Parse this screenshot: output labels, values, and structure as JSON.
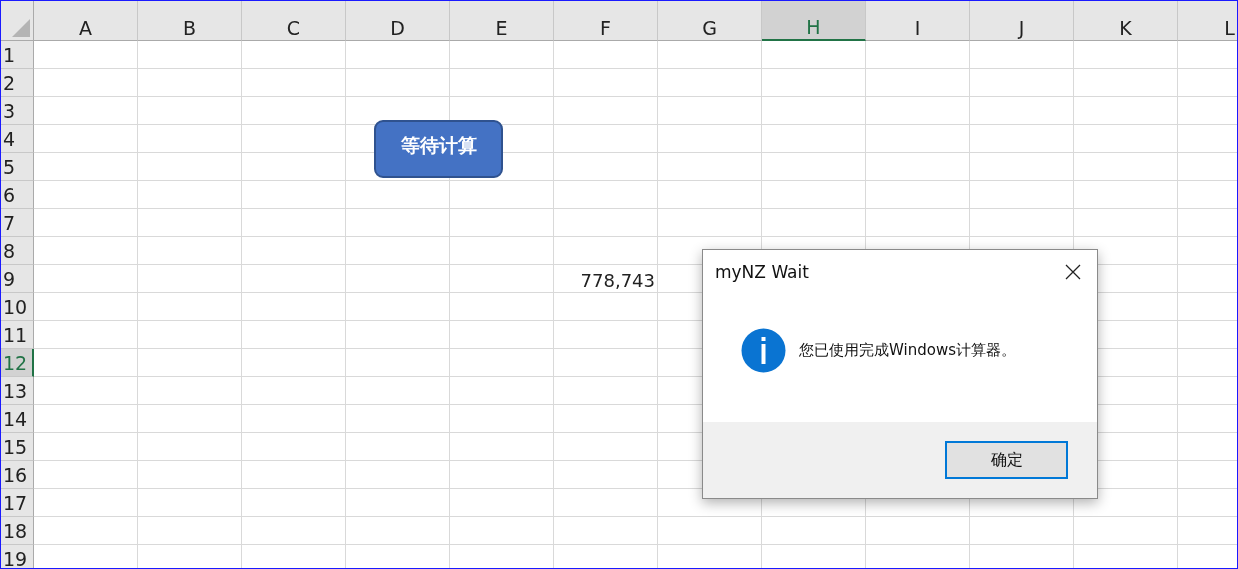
{
  "columns": [
    {
      "label": "A",
      "selected": false
    },
    {
      "label": "B",
      "selected": false
    },
    {
      "label": "C",
      "selected": false
    },
    {
      "label": "D",
      "selected": false
    },
    {
      "label": "E",
      "selected": false
    },
    {
      "label": "F",
      "selected": false
    },
    {
      "label": "G",
      "selected": false
    },
    {
      "label": "H",
      "selected": true
    },
    {
      "label": "I",
      "selected": false
    },
    {
      "label": "J",
      "selected": false
    },
    {
      "label": "K",
      "selected": false
    },
    {
      "label": "L",
      "selected": false
    }
  ],
  "rows": [
    {
      "label": "1",
      "selected": false
    },
    {
      "label": "2",
      "selected": false
    },
    {
      "label": "3",
      "selected": false
    },
    {
      "label": "4",
      "selected": false
    },
    {
      "label": "5",
      "selected": false
    },
    {
      "label": "6",
      "selected": false
    },
    {
      "label": "7",
      "selected": false
    },
    {
      "label": "8",
      "selected": false
    },
    {
      "label": "9",
      "selected": false,
      "cells": {
        "F": "778,743"
      }
    },
    {
      "label": "10",
      "selected": false
    },
    {
      "label": "11",
      "selected": false
    },
    {
      "label": "12",
      "selected": true
    },
    {
      "label": "13",
      "selected": false
    },
    {
      "label": "14",
      "selected": false
    },
    {
      "label": "15",
      "selected": false
    },
    {
      "label": "16",
      "selected": false
    },
    {
      "label": "17",
      "selected": false
    },
    {
      "label": "18",
      "selected": false
    },
    {
      "label": "19",
      "selected": false
    }
  ],
  "shape_button": {
    "label": "等待计算"
  },
  "dialog": {
    "title": "myNZ Wait",
    "message": "您已使用完成Windows计算器。",
    "ok_button": "确定"
  }
}
